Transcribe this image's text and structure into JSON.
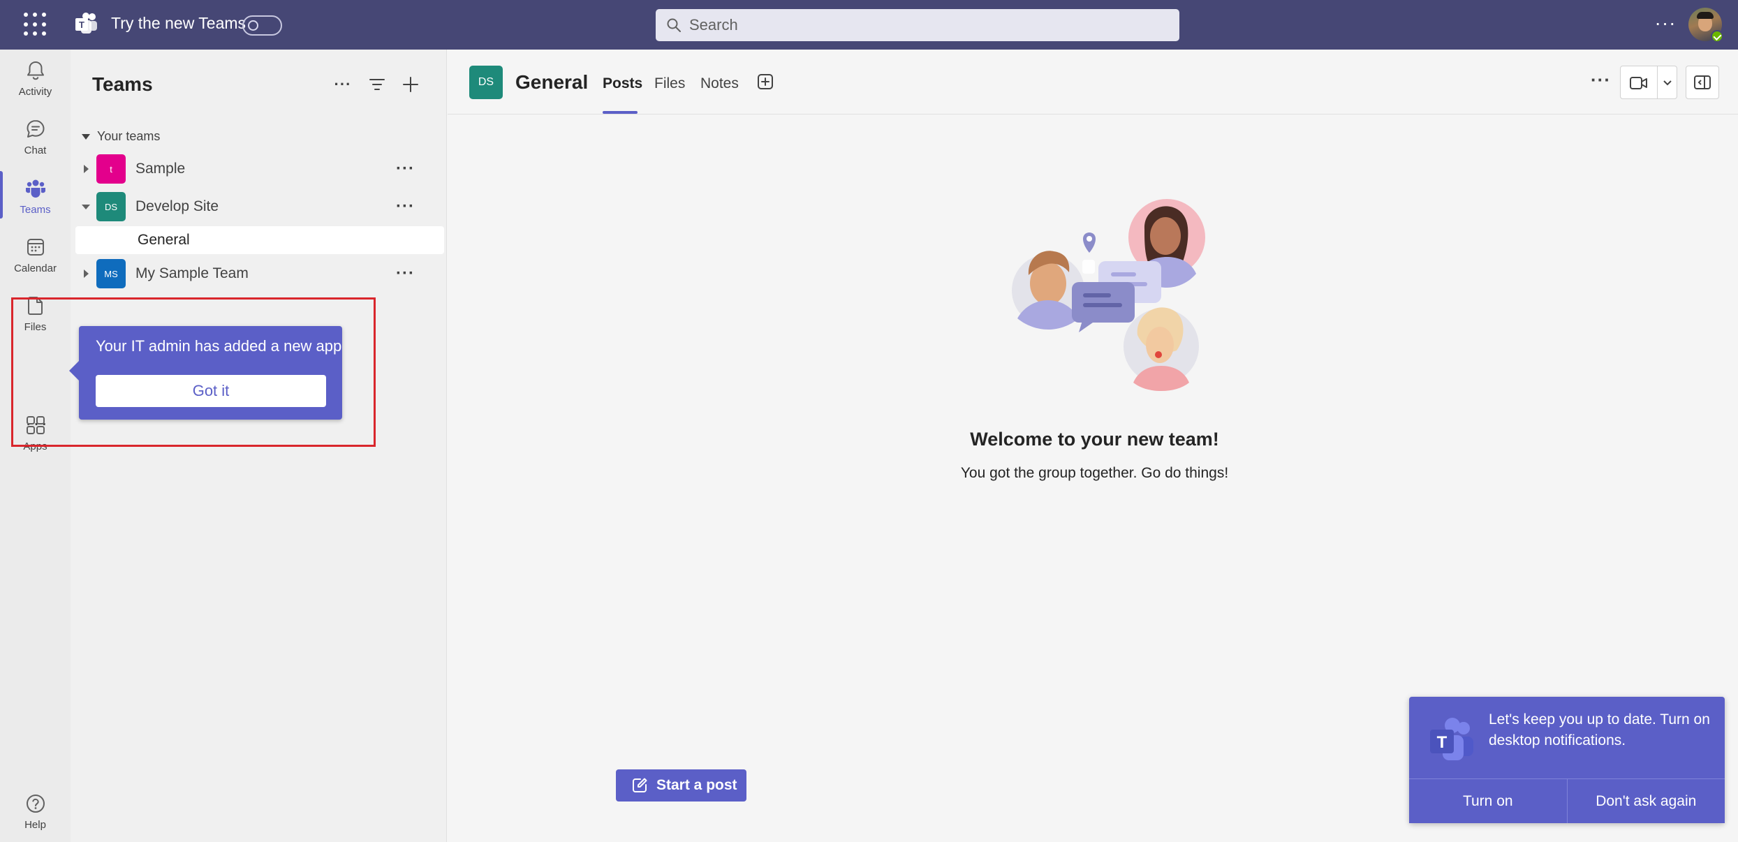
{
  "topbar": {
    "try_label": "Try the new Teams",
    "search_placeholder": "Search",
    "more_label": "···"
  },
  "rail": {
    "items": [
      {
        "label": "Activity"
      },
      {
        "label": "Chat"
      },
      {
        "label": "Teams"
      },
      {
        "label": "Calendar"
      },
      {
        "label": "Files"
      },
      {
        "label": "Apps"
      },
      {
        "label": "Help"
      }
    ],
    "more_label": "···"
  },
  "teams_panel": {
    "title": "Teams",
    "section": "Your teams",
    "teams": [
      {
        "name": "Sample",
        "avatar": "t",
        "color": "#e3008c"
      },
      {
        "name": "Develop Site",
        "avatar": "DS",
        "color": "#1e8a7a"
      },
      {
        "name": "My Sample Team",
        "avatar": "MS",
        "color": "#0f6cbd"
      }
    ],
    "channel": "General",
    "more_label": "···"
  },
  "callout": {
    "text": "Your IT admin has added a new app",
    "button": "Got it"
  },
  "channel_header": {
    "avatar": "DS",
    "title": "General",
    "tabs": [
      "Posts",
      "Files",
      "Notes"
    ],
    "more_label": "···"
  },
  "welcome": {
    "title": "Welcome to your new team!",
    "subtitle": "You got the group together. Go do things!"
  },
  "start_post": "Start a post",
  "toast": {
    "text": "Let's keep you up to date. Turn on desktop notifications.",
    "turn_on": "Turn on",
    "dont_ask": "Don't ask again"
  },
  "colors": {
    "brand": "#5b5fc7",
    "topbar": "#464775",
    "highlight": "#d9262c"
  }
}
